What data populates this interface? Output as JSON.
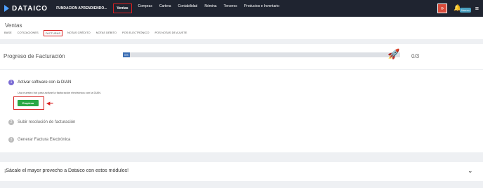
{
  "topbar": {
    "logo": "DATAICO",
    "company": "FUNDACION APRENDIENDO...",
    "nav": [
      "Ventas",
      "Compras",
      "Cartera",
      "Contabilidad",
      "Nómina",
      "Terceros",
      "Productos e Inventario"
    ],
    "active_nav": "Ventas",
    "badge": "Nuevo"
  },
  "header": {
    "title": "Ventas",
    "tabs": [
      "BASE",
      "COTIZACIONES",
      "FACTURAS",
      "NOTAS CRÉDITO",
      "NOTAS DÉBITO",
      "POS ELECTRÓNICO",
      "POS NOTAS DE AJUSTE"
    ],
    "selected_tab": "FACTURAS"
  },
  "progress": {
    "title": "Progreso de Facturación",
    "percent_label": "0%",
    "count": "0/3"
  },
  "steps": [
    {
      "num": "1",
      "label": "Activar software con la DIAN"
    },
    {
      "num": "2",
      "label": "Subir resolución de facturación"
    },
    {
      "num": "3",
      "label": "Generar Factura Electrónica"
    }
  ],
  "step1": {
    "description": "Usa nuestro bot para activar la facturación electrónica con la DIAN.",
    "button": "Empieza"
  },
  "modules": {
    "title": "¡Sácale el mayor provecho a Dataico con estos módulos!"
  }
}
